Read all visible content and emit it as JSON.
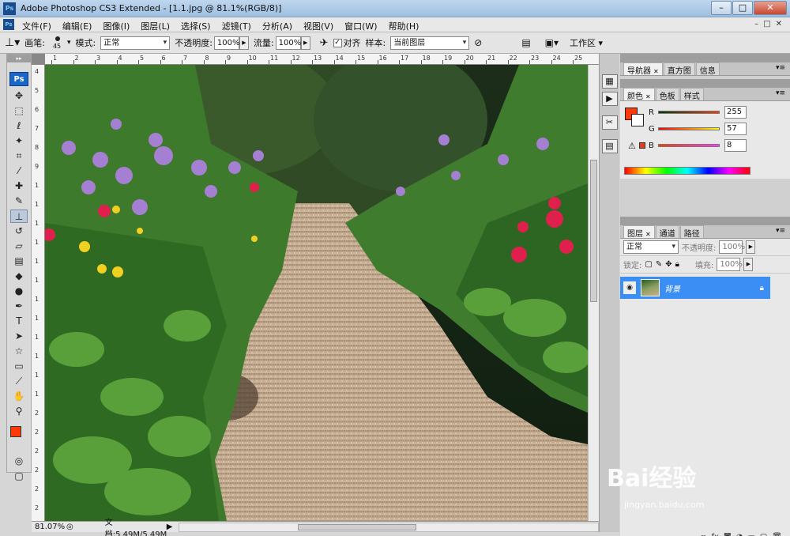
{
  "window": {
    "title": "Adobe Photoshop CS3 Extended - [1.1.jpg @ 81.1%(RGB/8)]",
    "app_icon": "Ps",
    "buttons": [
      "–",
      "□",
      "✕"
    ]
  },
  "menubar": {
    "items": [
      "文件(F)",
      "编辑(E)",
      "图像(I)",
      "图层(L)",
      "选择(S)",
      "滤镜(T)",
      "分析(A)",
      "视图(V)",
      "窗口(W)",
      "帮助(H)"
    ],
    "doc_buttons": [
      "–",
      "□",
      "✕"
    ]
  },
  "options": {
    "brush_label": "画笔:",
    "brush_size": "45",
    "mode_label": "模式:",
    "mode_value": "正常",
    "opacity_label": "不透明度:",
    "opacity_value": "100%",
    "flow_label": "流量:",
    "flow_value": "100%",
    "align_label": "对齐",
    "sample_label": "样本:",
    "sample_value": "当前图层",
    "workspace_label": "工作区 ▾"
  },
  "toolbar": {
    "logo": "Ps",
    "tools": [
      {
        "name": "move-tool",
        "glyph": "✥"
      },
      {
        "name": "marquee-tool",
        "glyph": "⬚"
      },
      {
        "name": "lasso-tool",
        "glyph": "ℓ"
      },
      {
        "name": "magic-wand-tool",
        "glyph": "✦"
      },
      {
        "name": "crop-tool",
        "glyph": "⌗"
      },
      {
        "name": "slice-tool",
        "glyph": "⁄"
      },
      {
        "name": "healing-brush-tool",
        "glyph": "✚"
      },
      {
        "name": "brush-tool",
        "glyph": "✎"
      },
      {
        "name": "clone-stamp-tool",
        "glyph": "⊥"
      },
      {
        "name": "history-brush-tool",
        "glyph": "↺"
      },
      {
        "name": "eraser-tool",
        "glyph": "▱"
      },
      {
        "name": "gradient-tool",
        "glyph": "▤"
      },
      {
        "name": "blur-tool",
        "glyph": "◆"
      },
      {
        "name": "dodge-tool",
        "glyph": "●"
      },
      {
        "name": "pen-tool",
        "glyph": "✒"
      },
      {
        "name": "type-tool",
        "glyph": "T"
      },
      {
        "name": "path-selection-tool",
        "glyph": "➤"
      },
      {
        "name": "shape-tool",
        "glyph": "☆"
      },
      {
        "name": "notes-tool",
        "glyph": "▭"
      },
      {
        "name": "eyedropper-tool",
        "glyph": "⟋"
      },
      {
        "name": "hand-tool",
        "glyph": "✋"
      },
      {
        "name": "zoom-tool",
        "glyph": "⚲"
      }
    ],
    "active_tool": "clone-stamp-tool",
    "foreground_color": "#ff3908",
    "background_color": "#ffffff"
  },
  "rulers": {
    "h_ticks": [
      "1",
      "2",
      "3",
      "4",
      "5",
      "6",
      "7",
      "8",
      "9",
      "10",
      "11",
      "12",
      "13",
      "14",
      "15",
      "16",
      "17",
      "18",
      "19",
      "20",
      "21",
      "22",
      "23",
      "24",
      "25"
    ],
    "v_ticks": [
      "4",
      "5",
      "6",
      "7",
      "8",
      "9",
      "1",
      "1",
      "1",
      "1",
      "1",
      "1",
      "1",
      "1",
      "1",
      "1",
      "1",
      "1",
      "2",
      "2",
      "2",
      "2",
      "2",
      "2"
    ]
  },
  "status": {
    "zoom": "81.07%",
    "doc_info": "文档:5.49M/5.49M"
  },
  "panels": {
    "navigator_tabs": [
      "导航器",
      "直方图",
      "信息"
    ],
    "color_tabs": [
      "颜色",
      "色板",
      "样式"
    ],
    "color": {
      "r_label": "R",
      "r_value": "255",
      "g_label": "G",
      "g_value": "57",
      "b_label": "B",
      "b_value": "8",
      "swatch": "#ff3908"
    },
    "layers_tabs": [
      "图层",
      "通道",
      "路径"
    ],
    "layers": {
      "blend_mode": "正常",
      "opacity_label": "不透明度:",
      "opacity_value": "100%",
      "lock_label": "锁定:",
      "fill_label": "填充:",
      "fill_value": "100%",
      "layer_name": "背景"
    }
  },
  "watermark": {
    "brand": "Bai经验",
    "url": "jingyan.baidu.com"
  }
}
